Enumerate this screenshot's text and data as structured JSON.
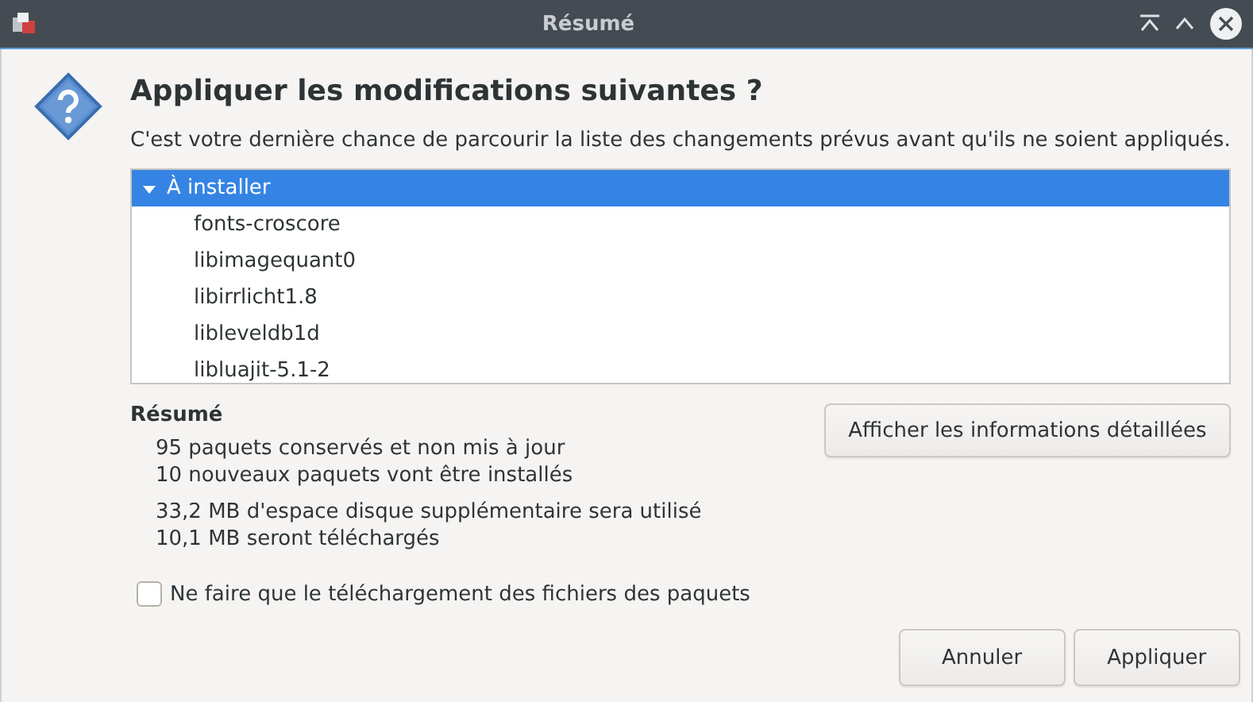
{
  "window": {
    "title": "Résumé"
  },
  "heading": "Appliquer les modifications suivantes ?",
  "description": "C'est votre dernière chance de parcourir la liste des changements prévus avant qu'ils ne soient appliqués.",
  "tree": [
    {
      "label": "À installer",
      "expanded": true,
      "selected": true,
      "children": [
        {
          "label": "fonts-croscore",
          "selected": false
        },
        {
          "label": "libimagequant0",
          "selected": false
        },
        {
          "label": "libirrlicht1.8",
          "selected": false
        },
        {
          "label": "libleveldb1d",
          "selected": false
        },
        {
          "label": "libluajit-5.1-2",
          "selected": false
        }
      ]
    }
  ],
  "summary": {
    "title": "Résumé",
    "groups": [
      [
        "95 paquets conservés et non mis à jour",
        "10 nouveaux paquets vont être installés"
      ],
      [
        "33,2 MB d'espace disque supplémentaire sera utilisé",
        "10,1 MB seront téléchargés"
      ]
    ]
  },
  "details_button": "Afficher les informations détaillées",
  "download_only": {
    "label": "Ne faire que le téléchargement des fichiers des paquets",
    "checked": false
  },
  "buttons": [
    "Annuler",
    "Appliquer"
  ]
}
